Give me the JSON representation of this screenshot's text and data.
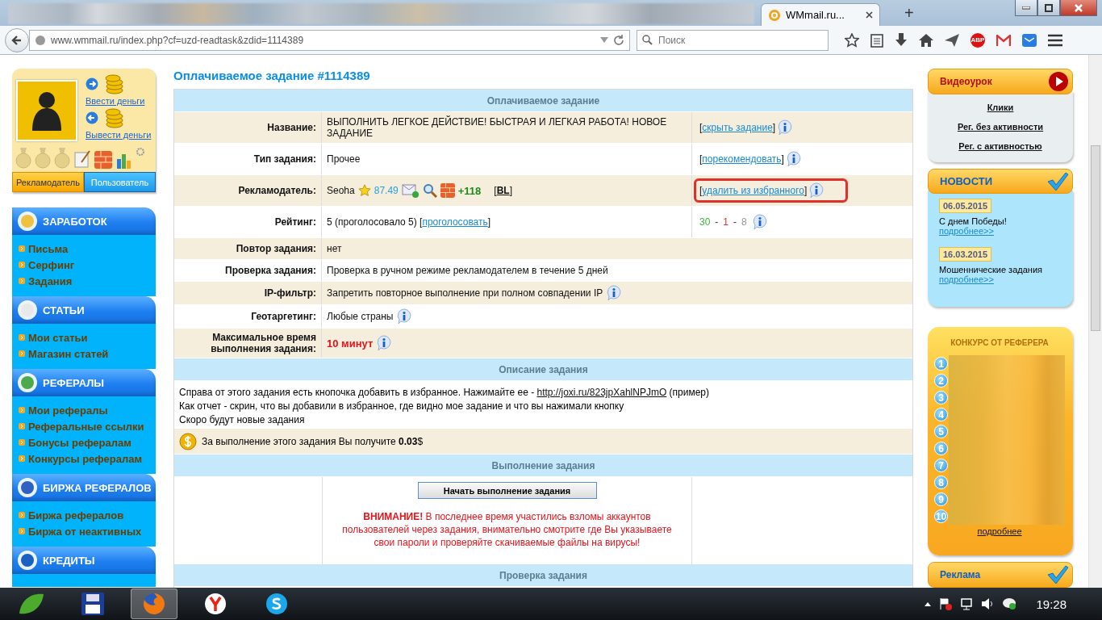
{
  "browser": {
    "tabs": [
      {
        "title": "WMmail.ru...",
        "selected": true
      }
    ],
    "new_tab": "+",
    "address": "www.wmmail.ru/index.php?cf=uzd-readtask&zdid=1114389",
    "search": {
      "placeholder": "Поиск"
    },
    "adblock_label": "ABP"
  },
  "user_card": {
    "links": [
      "Ввести деньги",
      "Вывести деньги"
    ],
    "roles": [
      {
        "label": "Рекламодатель",
        "selected": true
      },
      {
        "label": "Пользователь",
        "selected": false
      }
    ]
  },
  "menu": [
    {
      "kind": "earn",
      "title": "ЗАРАБОТОК",
      "items": [
        "Письма",
        "Серфинг",
        "Задания"
      ]
    },
    {
      "kind": "articles",
      "title": "СТАТЬИ",
      "items": [
        "Мои статьи",
        "Магазин статей"
      ]
    },
    {
      "kind": "referrals",
      "title": "РЕФЕРАЛЫ",
      "items": [
        "Мои рефералы",
        "Реферальные ссылки",
        "Бонусы рефералам",
        "Конкурсы рефералам"
      ]
    },
    {
      "kind": "exchange",
      "title": "БИРЖА РЕФЕРАЛОВ",
      "items": [
        "Биржа рефералов",
        "Биржа от неактивных"
      ]
    },
    {
      "kind": "credits",
      "title": "КРЕДИТЫ"
    }
  ],
  "task": {
    "title": "Оплачиваемое задание #1114389",
    "header": "Оплачиваемое задание",
    "rows": [
      {
        "kind": "text",
        "label": "Название:",
        "value": {
          "text": "ВЫПОЛНИТЬ ЛЕГКОЕ ДЕЙСТВИЕ! БЫСТРАЯ И ЛЕГКАЯ РАБОТА! НОВОЕ ЗАДАНИЕ"
        },
        "info": false,
        "action": {
          "text": "[",
          "link": "скрыть задание",
          "after": "]",
          "info": true,
          "highlighted": false
        }
      },
      {
        "kind": "text",
        "label": "Тип задания:",
        "value": {
          "text": "Прочее"
        },
        "info": false,
        "action": {
          "text": "[",
          "link": "порекомендовать",
          "after": "]",
          "info": true,
          "highlighted": false
        }
      },
      {
        "kind": "advertiser",
        "label": "Рекламодатель:",
        "name": "Seoha",
        "score": "87.49",
        "plus": "+118",
        "bl": {
          "text": "[",
          "link": "BL",
          "after": "]"
        },
        "info": false,
        "action": {
          "text": "[",
          "link": "удалить из избранного",
          "after": "]",
          "info": true,
          "highlighted": true
        }
      },
      {
        "kind": "text",
        "label": "Рейтинг:",
        "value": {
          "text": "5 (проголосовало 5) [",
          "link": "проголосовать",
          "after": "]"
        },
        "info": false,
        "action": {
          "votes": [
            {
              "text": "30",
              "color": "#3cb43c"
            },
            {
              "text": "-"
            },
            {
              "text": "1",
              "color": "#d03a2a"
            },
            {
              "text": "-"
            },
            {
              "text": "8",
              "color": "#999999"
            }
          ],
          "info": true,
          "highlighted": false
        }
      },
      {
        "kind": "text",
        "label": "Повтор задания:",
        "value": {
          "text": "нет"
        },
        "info": false
      },
      {
        "kind": "text",
        "label": "Проверка задания:",
        "value": {
          "text": "Проверка в ручном режиме рекламодателем в течение 5 дней"
        },
        "info": false
      },
      {
        "kind": "text",
        "label": "IP-фильтр:",
        "value": {
          "text": "Запретить повторное выполнение при полном совпадении IP"
        },
        "info": true
      },
      {
        "kind": "text",
        "label": "Геотаргетинг:",
        "value": {
          "text": "Любые страны"
        },
        "info": true
      },
      {
        "kind": "alert",
        "label": "Максимальное время выполнения задания:",
        "value": {
          "text": "10 минут"
        },
        "info": true
      }
    ],
    "description_header": "Описание задания",
    "description": [
      {
        "text": "Справа от этого задания есть кнопочка добавить в избранное. Нажимайте ее - ",
        "link": "http://joxi.ru/823jpXahlNPJmO",
        "after": " (пример)"
      },
      {
        "text": "Как отчет - скрин, что вы добавили в избранное, где видно мое задание и что вы нажимали кнопку"
      },
      {
        "text": "Скоро будут новые задания"
      }
    ],
    "reward": "За выполнение этого задания Вы получите **0.03**$",
    "execution_header": "Выполнение задания",
    "start_button": "Начать выполнение задания",
    "warning": "**ВНИМАНИЕ!** В последнее время участились взломы аккаунтов пользователей через задания, внимательно смотрите где Вы указываете свои пароли и проверяйте скачиваемые файлы на вирусы!",
    "check_header": "Проверка задания"
  },
  "video": {
    "title": "Видеоурок",
    "links": [
      "Клики",
      "Рег. без активности",
      "Рег. с активностью"
    ]
  },
  "news": {
    "title": "НОВОСТИ",
    "items": [
      {
        "date": "06.05.2015",
        "title": "С днем Победы!",
        "more": "подробнее>>"
      },
      {
        "date": "16.03.2015",
        "title": "Мошеннические задания",
        "more": "подробнее>>"
      }
    ]
  },
  "contest": {
    "title": "КОНКУРС ОТ РЕФЕРЕРА",
    "ranks": [
      "1",
      "2",
      "3",
      "4",
      "5",
      "6",
      "7",
      "8",
      "9",
      "10"
    ],
    "more": "подробнее"
  },
  "ads": {
    "title": "Реклама"
  },
  "taskbar": {
    "time": "19:28"
  }
}
